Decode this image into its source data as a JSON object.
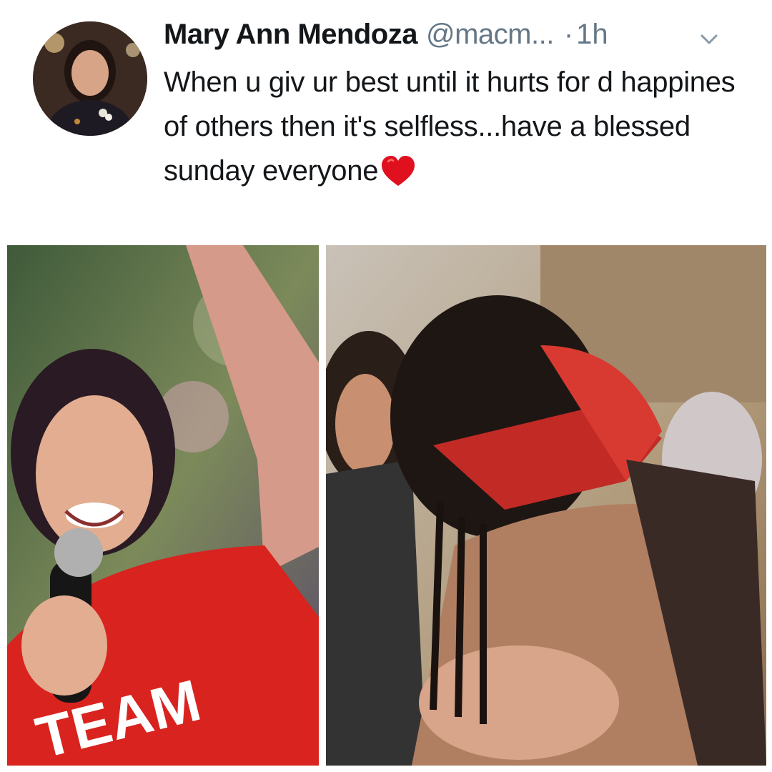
{
  "tweet": {
    "author_name": "Mary Ann Mendoza",
    "handle": "@macm...",
    "separator": "·",
    "time": "1h",
    "text": "When u giv ur best until it hurts for d happines of others then it's selfless...have a blessed sunday everyone",
    "emoji": "heart-emoji",
    "menu_icon": "chevron-down-icon"
  },
  "media": {
    "left_shirt_text": "TEAM"
  },
  "colors": {
    "text_primary": "#14171a",
    "text_secondary": "#657786",
    "heart": "#e0101e"
  }
}
